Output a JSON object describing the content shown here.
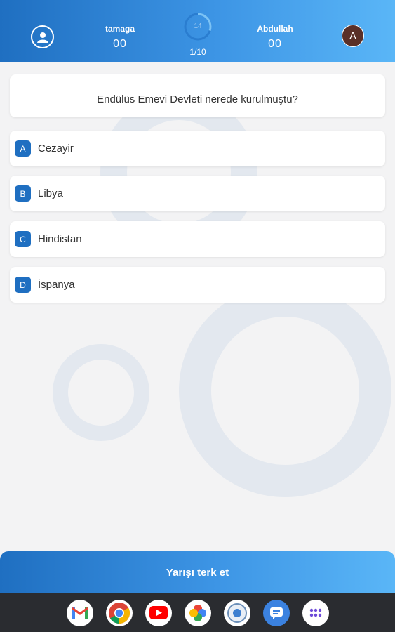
{
  "header": {
    "player1": {
      "name": "tamaga",
      "score": "00"
    },
    "player2": {
      "name": "Abdullah",
      "score": "00",
      "avatar_letter": "A"
    },
    "timer": {
      "value": "14",
      "progress": 0.3
    },
    "question_counter": "1/10"
  },
  "question": {
    "text": "Endülüs Emevi Devleti nerede kurulmuştu?"
  },
  "options": [
    {
      "letter": "A",
      "text": "Cezayir"
    },
    {
      "letter": "B",
      "text": "Libya"
    },
    {
      "letter": "C",
      "text": "Hindistan"
    },
    {
      "letter": "D",
      "text": "İspanya"
    }
  ],
  "footer": {
    "leave_label": "Yarışı terk et"
  },
  "dock": {
    "apps": [
      "gmail-icon",
      "chrome-icon",
      "youtube-icon",
      "photos-icon",
      "app-icon",
      "messages-icon",
      "app-drawer-icon"
    ]
  },
  "colors": {
    "primary": "#1f6fc1",
    "gradient_end": "#5ab6f7",
    "background": "#f3f3f4",
    "avatar": "#5a3028"
  }
}
